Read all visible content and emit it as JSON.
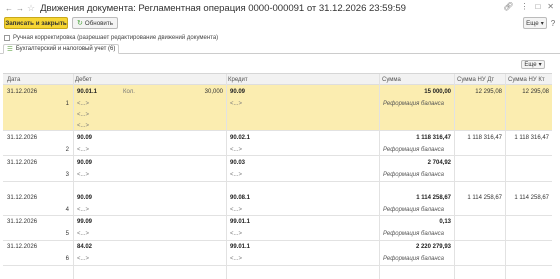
{
  "window": {
    "title": "Движения документа: Регламентная операция 0000-000091 от 31.12.2026 23:59:59",
    "back_icon": "arrow-left-icon",
    "forward_icon": "arrow-right-icon",
    "star_icon": "star-icon",
    "link_icon": "link-icon",
    "menu_icon": "kebab-menu-icon",
    "maximize_icon": "maximize-icon",
    "close_icon": "close-icon"
  },
  "toolbar": {
    "save_close_label": "Записать и закрыть",
    "refresh_label": "Обновить",
    "more_label": "Еще",
    "help_label": "?"
  },
  "manual_edit": {
    "label": "Ручная корректировка (разрешает редактирование движений документа)",
    "checked": false
  },
  "tabs": [
    {
      "label": "Бухгалтерский и налоговый учет (6)"
    }
  ],
  "table": {
    "more_label": "Еще",
    "columns": [
      "Дата",
      "Дебет",
      "Кредит",
      "Сумма",
      "Сумма НУ Дт",
      "Сумма НУ Кт"
    ],
    "rows": [
      {
        "date": "31.12.2026",
        "num": "1",
        "debit_account": "90.01.1",
        "debit_sub": [
          "<...>",
          "<...>",
          "<...>"
        ],
        "debit_qty_label": "Кол.",
        "debit_qty": "30,000",
        "credit_account": "90.09",
        "credit_sub": [
          "<...>"
        ],
        "amount": "15 000,00",
        "description": "Реформация баланса",
        "nu_dt": "12 295,08",
        "nu_kt": "12 295,08"
      },
      {
        "date": "31.12.2026",
        "num": "2",
        "debit_account": "90.09",
        "debit_sub": [
          "<...>"
        ],
        "credit_account": "90.02.1",
        "credit_sub": [
          "<...>"
        ],
        "amount": "1 118 316,47",
        "description": "Реформация баланса",
        "nu_dt": "1 118 316,47",
        "nu_kt": "1 118 316,47"
      },
      {
        "date": "31.12.2026",
        "num": "3",
        "debit_account": "90.09",
        "debit_sub": [
          "<...>"
        ],
        "credit_account": "90.03",
        "credit_sub": [
          "<...>"
        ],
        "amount": "2 704,92",
        "description": "Реформация баланса",
        "nu_dt": "",
        "nu_kt": ""
      },
      {
        "date": "31.12.2026",
        "num": "4",
        "debit_account": "90.09",
        "debit_sub": [
          "<...>"
        ],
        "credit_account": "90.08.1",
        "credit_sub": [
          "<...>"
        ],
        "amount": "1 114 258,67",
        "description": "Реформация баланса",
        "nu_dt": "1 114 258,67",
        "nu_kt": "1 114 258,67"
      },
      {
        "date": "31.12.2026",
        "num": "5",
        "debit_account": "99.09",
        "debit_sub": [
          "<...>"
        ],
        "credit_account": "99.01.1",
        "credit_sub": [
          "<...>"
        ],
        "amount": "0,13",
        "description": "Реформация баланса",
        "nu_dt": "",
        "nu_kt": ""
      },
      {
        "date": "31.12.2026",
        "num": "6",
        "debit_account": "84.02",
        "debit_sub": [
          "<...>"
        ],
        "credit_account": "99.01.1",
        "credit_sub": [
          "<...>"
        ],
        "amount": "2 220 279,93",
        "description": "Реформация баланса",
        "nu_dt": "",
        "nu_kt": ""
      }
    ]
  },
  "colors": {
    "selected_row": "#fbedb0",
    "primary_button": "#f6d533",
    "header_bg": "#f2f2f2"
  }
}
